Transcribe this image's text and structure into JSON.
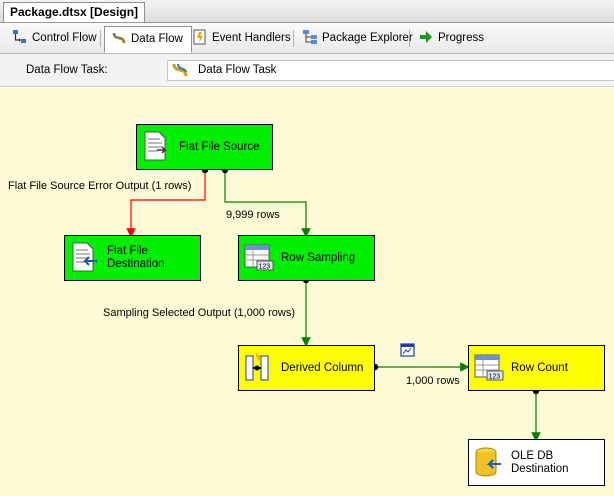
{
  "document_tab": "Package.dtsx [Design]",
  "tabs": [
    {
      "label": "Control Flow",
      "icon": "control-flow-icon"
    },
    {
      "label": "Data Flow",
      "icon": "data-flow-icon",
      "active": true
    },
    {
      "label": "Event Handlers",
      "icon": "event-handlers-icon"
    },
    {
      "label": "Package Explorer",
      "icon": "package-explorer-icon"
    },
    {
      "label": "Progress",
      "icon": "progress-arrow-icon"
    }
  ],
  "task_selector": {
    "label": "Data Flow Task:",
    "value": "Data Flow Task",
    "icon": "data-flow-task-icon"
  },
  "components": {
    "flat_file_source": {
      "label": "Flat File Source",
      "status": "green",
      "icon": "flat-file-source-icon"
    },
    "flat_file_destination": {
      "label": "Flat File Destination",
      "status": "green",
      "icon": "flat-file-destination-icon"
    },
    "row_sampling": {
      "label": "Row Sampling",
      "status": "green",
      "icon": "row-sampling-icon"
    },
    "derived_column": {
      "label": "Derived Column",
      "status": "yellow",
      "icon": "derived-column-icon"
    },
    "row_count": {
      "label": "Row Count",
      "status": "yellow",
      "icon": "row-count-icon"
    },
    "ole_db_destination": {
      "label": "OLE DB Destination",
      "status": "white",
      "icon": "ole-db-destination-icon"
    }
  },
  "paths": {
    "error_output": "Flat File Source Error Output (1 rows)",
    "source_to_sampling": "9,999 rows",
    "sampling_output": "Sampling Selected Output (1,000 rows)",
    "derived_to_count": "1,000 rows"
  },
  "colors": {
    "canvas": "#fdfbd5",
    "success": "#00ee00",
    "executing": "#ffff00",
    "data_path": "#008000",
    "error_path": "#ff0000"
  }
}
